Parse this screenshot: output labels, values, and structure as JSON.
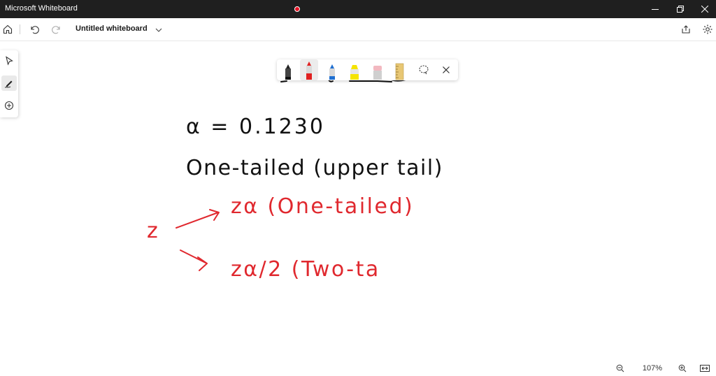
{
  "app": {
    "title": "Microsoft Whiteboard"
  },
  "toolbar": {
    "board_title": "Untitled whiteboard"
  },
  "left_tools": [
    "select-icon",
    "ink-icon",
    "add-icon"
  ],
  "pen_tray": {
    "tools": [
      {
        "name": "black-pen",
        "color": "#1a1a1a"
      },
      {
        "name": "red-pen",
        "color": "#e02020"
      },
      {
        "name": "blue-pen",
        "color": "#1f6fd1"
      },
      {
        "name": "yellow-highlighter",
        "color": "#f5e400"
      },
      {
        "name": "eraser",
        "color": "#f2b8c0"
      },
      {
        "name": "ruler",
        "color": "#e8c774"
      }
    ]
  },
  "ink": {
    "line1": "α = 0.1230",
    "line2": "One-tailed (upper tail)",
    "line3_prefix": "z",
    "line3": "zα (One-tailed)",
    "line4": "zα/2 (Two-ta",
    "black_color": "#111111",
    "red_color": "#e0282e"
  },
  "zoom": {
    "level": "107%"
  }
}
